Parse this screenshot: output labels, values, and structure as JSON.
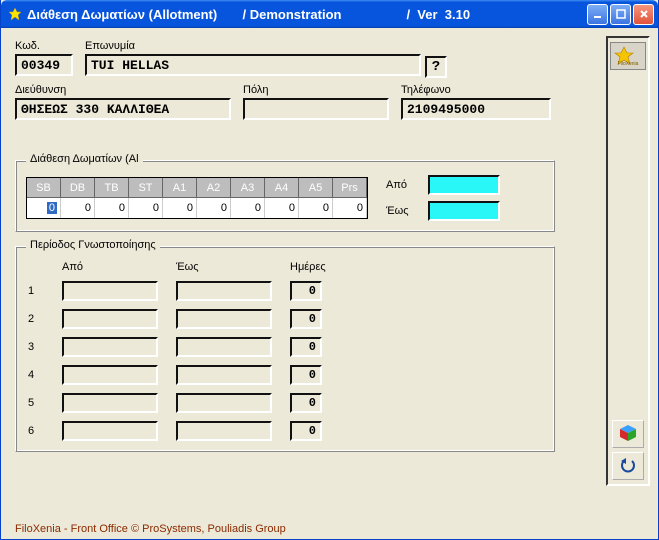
{
  "title": "Διάθεση Δωματίων (Allotment)       / Demonstration                  /  Ver  3.10",
  "labels": {
    "kod": "Κωδ.",
    "eponimia": "Επωνυμία",
    "address": "Διεύθυνση",
    "city": "Πόλη",
    "phone": "Τηλέφωνο",
    "qmark": "?"
  },
  "fields": {
    "code": "00349",
    "name": "TUI HELLAS",
    "address": "ΘΗΣΕΩΣ 330 ΚΑΛΛΙΘΕΑ",
    "city": "",
    "phone": "2109495000"
  },
  "alloc": {
    "legend": "Διάθεση Δωματίων (Al",
    "headers": [
      "SB",
      "DB",
      "TB",
      "ST",
      "A1",
      "A2",
      "A3",
      "A4",
      "A5",
      "Prs"
    ],
    "values": [
      "0",
      "0",
      "0",
      "0",
      "0",
      "0",
      "0",
      "0",
      "0",
      "0"
    ],
    "apo": "Από",
    "eos": "Έως"
  },
  "period": {
    "legend": "Περίοδος Γνωστοποίησης",
    "head_apo": "Από",
    "head_eos": "Έως",
    "head_days": "Ημέρες",
    "rows": [
      {
        "n": "1",
        "apo": "",
        "eos": "",
        "days": "0"
      },
      {
        "n": "2",
        "apo": "",
        "eos": "",
        "days": "0"
      },
      {
        "n": "3",
        "apo": "",
        "eos": "",
        "days": "0"
      },
      {
        "n": "4",
        "apo": "",
        "eos": "",
        "days": "0"
      },
      {
        "n": "5",
        "apo": "",
        "eos": "",
        "days": "0"
      },
      {
        "n": "6",
        "apo": "",
        "eos": "",
        "days": "0"
      }
    ]
  },
  "footer": "FiloXenia - Front Office   © ProSystems,  Pouliadis Group",
  "side": {
    "logo": "FiloXenia"
  }
}
